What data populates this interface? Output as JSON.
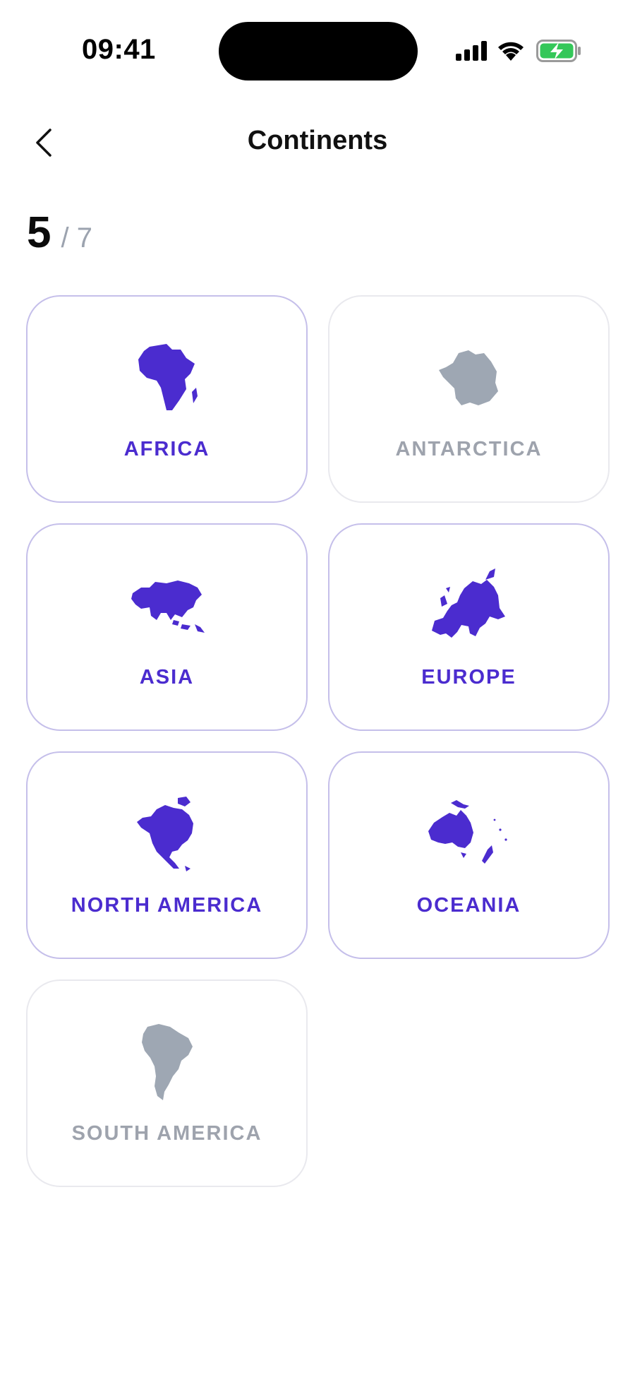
{
  "status_bar": {
    "time": "09:41",
    "icons": [
      "signal-icon",
      "wifi-icon",
      "battery-charging-icon"
    ]
  },
  "nav": {
    "back_icon": "chevron-left-icon",
    "title": "Continents"
  },
  "progress": {
    "count": "5",
    "total": "/ 7"
  },
  "colors": {
    "accent": "#4b2ccf",
    "locked": "#9ea3ad",
    "card_border_active": "#c5bfea",
    "card_border_locked": "#e9e9ee",
    "battery_green": "#34c759"
  },
  "continents": [
    {
      "label": "AFRICA",
      "unlocked": true,
      "icon": "africa-map-icon"
    },
    {
      "label": "ANTARCTICA",
      "unlocked": false,
      "icon": "antarctica-map-icon"
    },
    {
      "label": "ASIA",
      "unlocked": true,
      "icon": "asia-map-icon"
    },
    {
      "label": "EUROPE",
      "unlocked": true,
      "icon": "europe-map-icon"
    },
    {
      "label": "NORTH AMERICA",
      "unlocked": true,
      "icon": "north-america-map-icon"
    },
    {
      "label": "OCEANIA",
      "unlocked": true,
      "icon": "oceania-map-icon"
    },
    {
      "label": "SOUTH AMERICA",
      "unlocked": false,
      "icon": "south-america-map-icon"
    }
  ]
}
